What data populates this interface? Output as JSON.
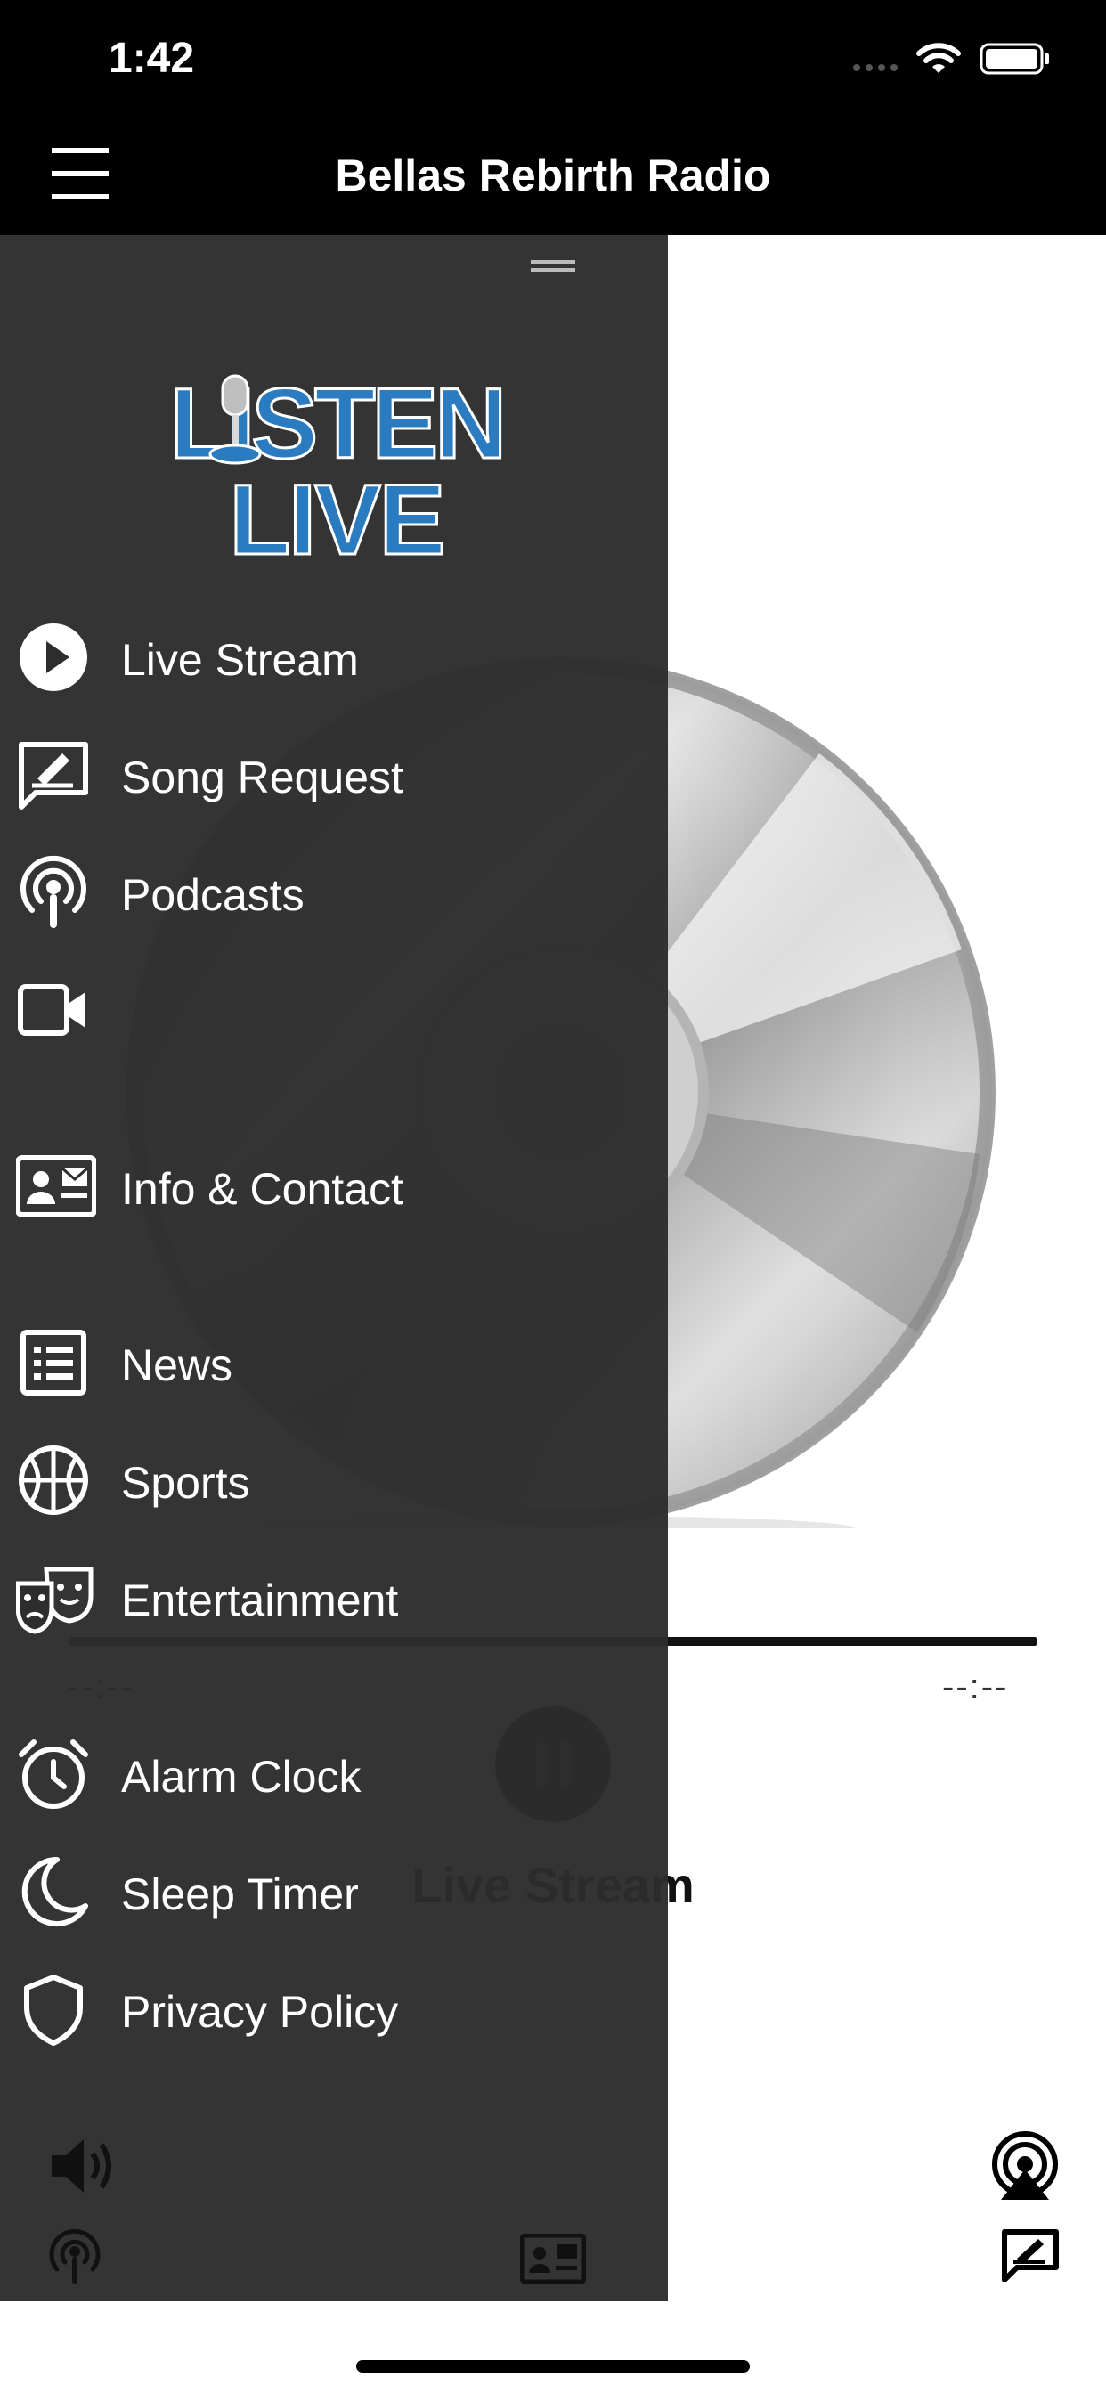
{
  "status_bar": {
    "time": "1:42"
  },
  "nav": {
    "title": "Bellas Rebirth Radio"
  },
  "logo": {
    "line1": "LISTEN",
    "line2": "LIVE"
  },
  "menu": [
    {
      "label": "Live Stream",
      "icon": "play-circle-icon"
    },
    {
      "label": "Song Request",
      "icon": "pen-signature-icon"
    },
    {
      "label": "Podcasts",
      "icon": "podcast-icon"
    },
    {
      "label": "",
      "icon": "video-camera-icon"
    },
    {
      "label": "Info & Contact",
      "icon": "contact-card-icon"
    },
    {
      "label": "News",
      "icon": "news-list-icon"
    },
    {
      "label": "Sports",
      "icon": "basketball-icon"
    },
    {
      "label": "Entertainment",
      "icon": "theater-masks-icon"
    },
    {
      "label": "Alarm Clock",
      "icon": "alarm-clock-icon"
    },
    {
      "label": "Sleep Timer",
      "icon": "moon-icon"
    },
    {
      "label": "Privacy Policy",
      "icon": "shield-icon"
    }
  ],
  "player": {
    "elapsed": "--:--",
    "remaining": "--:--",
    "stream_name": "Live Stream",
    "progress": 0
  },
  "colors": {
    "logo_blue": "#2a7bbf",
    "drawer_bg": "#2d2d2d",
    "bar_bg": "#000000"
  }
}
